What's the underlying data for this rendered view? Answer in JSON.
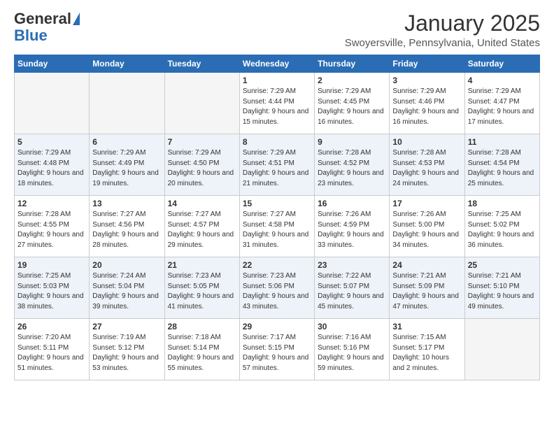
{
  "logo": {
    "general": "General",
    "blue": "Blue"
  },
  "header": {
    "month": "January 2025",
    "location": "Swoyersville, Pennsylvania, United States"
  },
  "weekdays": [
    "Sunday",
    "Monday",
    "Tuesday",
    "Wednesday",
    "Thursday",
    "Friday",
    "Saturday"
  ],
  "weeks": [
    [
      {
        "day": "",
        "sunrise": "",
        "sunset": "",
        "daylight": ""
      },
      {
        "day": "",
        "sunrise": "",
        "sunset": "",
        "daylight": ""
      },
      {
        "day": "",
        "sunrise": "",
        "sunset": "",
        "daylight": ""
      },
      {
        "day": "1",
        "sunrise": "Sunrise: 7:29 AM",
        "sunset": "Sunset: 4:44 PM",
        "daylight": "Daylight: 9 hours and 15 minutes."
      },
      {
        "day": "2",
        "sunrise": "Sunrise: 7:29 AM",
        "sunset": "Sunset: 4:45 PM",
        "daylight": "Daylight: 9 hours and 16 minutes."
      },
      {
        "day": "3",
        "sunrise": "Sunrise: 7:29 AM",
        "sunset": "Sunset: 4:46 PM",
        "daylight": "Daylight: 9 hours and 16 minutes."
      },
      {
        "day": "4",
        "sunrise": "Sunrise: 7:29 AM",
        "sunset": "Sunset: 4:47 PM",
        "daylight": "Daylight: 9 hours and 17 minutes."
      }
    ],
    [
      {
        "day": "5",
        "sunrise": "Sunrise: 7:29 AM",
        "sunset": "Sunset: 4:48 PM",
        "daylight": "Daylight: 9 hours and 18 minutes."
      },
      {
        "day": "6",
        "sunrise": "Sunrise: 7:29 AM",
        "sunset": "Sunset: 4:49 PM",
        "daylight": "Daylight: 9 hours and 19 minutes."
      },
      {
        "day": "7",
        "sunrise": "Sunrise: 7:29 AM",
        "sunset": "Sunset: 4:50 PM",
        "daylight": "Daylight: 9 hours and 20 minutes."
      },
      {
        "day": "8",
        "sunrise": "Sunrise: 7:29 AM",
        "sunset": "Sunset: 4:51 PM",
        "daylight": "Daylight: 9 hours and 21 minutes."
      },
      {
        "day": "9",
        "sunrise": "Sunrise: 7:28 AM",
        "sunset": "Sunset: 4:52 PM",
        "daylight": "Daylight: 9 hours and 23 minutes."
      },
      {
        "day": "10",
        "sunrise": "Sunrise: 7:28 AM",
        "sunset": "Sunset: 4:53 PM",
        "daylight": "Daylight: 9 hours and 24 minutes."
      },
      {
        "day": "11",
        "sunrise": "Sunrise: 7:28 AM",
        "sunset": "Sunset: 4:54 PM",
        "daylight": "Daylight: 9 hours and 25 minutes."
      }
    ],
    [
      {
        "day": "12",
        "sunrise": "Sunrise: 7:28 AM",
        "sunset": "Sunset: 4:55 PM",
        "daylight": "Daylight: 9 hours and 27 minutes."
      },
      {
        "day": "13",
        "sunrise": "Sunrise: 7:27 AM",
        "sunset": "Sunset: 4:56 PM",
        "daylight": "Daylight: 9 hours and 28 minutes."
      },
      {
        "day": "14",
        "sunrise": "Sunrise: 7:27 AM",
        "sunset": "Sunset: 4:57 PM",
        "daylight": "Daylight: 9 hours and 29 minutes."
      },
      {
        "day": "15",
        "sunrise": "Sunrise: 7:27 AM",
        "sunset": "Sunset: 4:58 PM",
        "daylight": "Daylight: 9 hours and 31 minutes."
      },
      {
        "day": "16",
        "sunrise": "Sunrise: 7:26 AM",
        "sunset": "Sunset: 4:59 PM",
        "daylight": "Daylight: 9 hours and 33 minutes."
      },
      {
        "day": "17",
        "sunrise": "Sunrise: 7:26 AM",
        "sunset": "Sunset: 5:00 PM",
        "daylight": "Daylight: 9 hours and 34 minutes."
      },
      {
        "day": "18",
        "sunrise": "Sunrise: 7:25 AM",
        "sunset": "Sunset: 5:02 PM",
        "daylight": "Daylight: 9 hours and 36 minutes."
      }
    ],
    [
      {
        "day": "19",
        "sunrise": "Sunrise: 7:25 AM",
        "sunset": "Sunset: 5:03 PM",
        "daylight": "Daylight: 9 hours and 38 minutes."
      },
      {
        "day": "20",
        "sunrise": "Sunrise: 7:24 AM",
        "sunset": "Sunset: 5:04 PM",
        "daylight": "Daylight: 9 hours and 39 minutes."
      },
      {
        "day": "21",
        "sunrise": "Sunrise: 7:23 AM",
        "sunset": "Sunset: 5:05 PM",
        "daylight": "Daylight: 9 hours and 41 minutes."
      },
      {
        "day": "22",
        "sunrise": "Sunrise: 7:23 AM",
        "sunset": "Sunset: 5:06 PM",
        "daylight": "Daylight: 9 hours and 43 minutes."
      },
      {
        "day": "23",
        "sunrise": "Sunrise: 7:22 AM",
        "sunset": "Sunset: 5:07 PM",
        "daylight": "Daylight: 9 hours and 45 minutes."
      },
      {
        "day": "24",
        "sunrise": "Sunrise: 7:21 AM",
        "sunset": "Sunset: 5:09 PM",
        "daylight": "Daylight: 9 hours and 47 minutes."
      },
      {
        "day": "25",
        "sunrise": "Sunrise: 7:21 AM",
        "sunset": "Sunset: 5:10 PM",
        "daylight": "Daylight: 9 hours and 49 minutes."
      }
    ],
    [
      {
        "day": "26",
        "sunrise": "Sunrise: 7:20 AM",
        "sunset": "Sunset: 5:11 PM",
        "daylight": "Daylight: 9 hours and 51 minutes."
      },
      {
        "day": "27",
        "sunrise": "Sunrise: 7:19 AM",
        "sunset": "Sunset: 5:12 PM",
        "daylight": "Daylight: 9 hours and 53 minutes."
      },
      {
        "day": "28",
        "sunrise": "Sunrise: 7:18 AM",
        "sunset": "Sunset: 5:14 PM",
        "daylight": "Daylight: 9 hours and 55 minutes."
      },
      {
        "day": "29",
        "sunrise": "Sunrise: 7:17 AM",
        "sunset": "Sunset: 5:15 PM",
        "daylight": "Daylight: 9 hours and 57 minutes."
      },
      {
        "day": "30",
        "sunrise": "Sunrise: 7:16 AM",
        "sunset": "Sunset: 5:16 PM",
        "daylight": "Daylight: 9 hours and 59 minutes."
      },
      {
        "day": "31",
        "sunrise": "Sunrise: 7:15 AM",
        "sunset": "Sunset: 5:17 PM",
        "daylight": "Daylight: 10 hours and 2 minutes."
      },
      {
        "day": "",
        "sunrise": "",
        "sunset": "",
        "daylight": ""
      }
    ]
  ]
}
